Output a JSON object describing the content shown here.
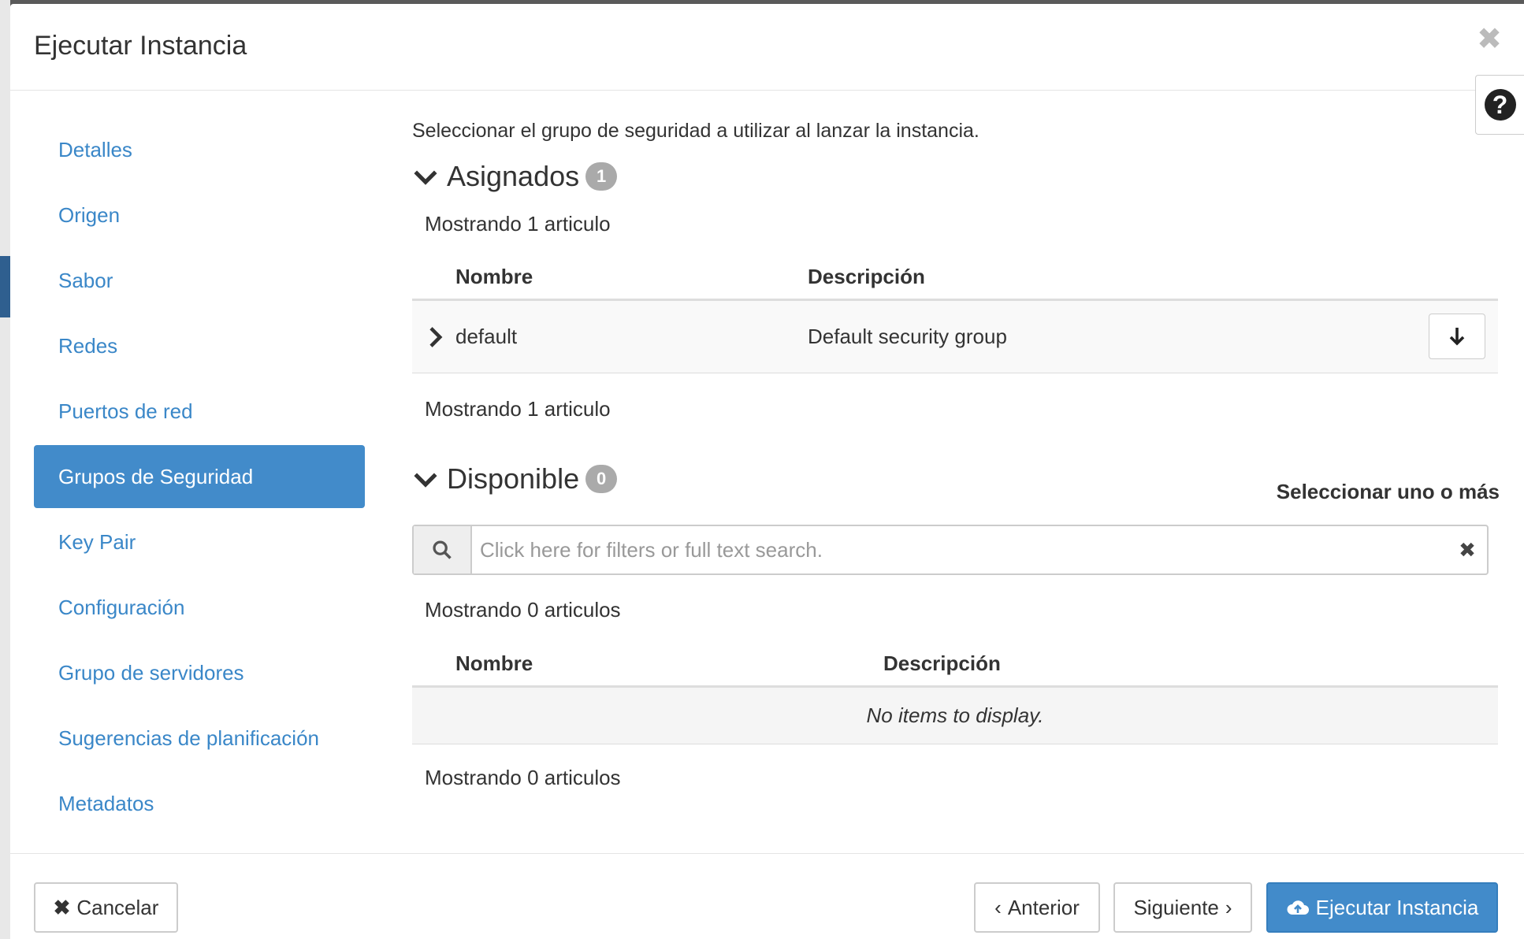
{
  "modal": {
    "title": "Ejecutar Instancia",
    "help_label": "?"
  },
  "sidebar": {
    "items": [
      {
        "label": "Detalles"
      },
      {
        "label": "Origen"
      },
      {
        "label": "Sabor"
      },
      {
        "label": "Redes"
      },
      {
        "label": "Puertos de red"
      },
      {
        "label": "Grupos de Seguridad",
        "active": true
      },
      {
        "label": "Key Pair"
      },
      {
        "label": "Configuración"
      },
      {
        "label": "Grupo de servidores"
      },
      {
        "label": "Sugerencias de planificación"
      },
      {
        "label": "Metadatos"
      }
    ]
  },
  "main": {
    "intro": "Seleccionar el grupo de seguridad a utilizar al lanzar la instancia.",
    "assigned": {
      "title": "Asignados",
      "badge": "1",
      "count_top": "Mostrando 1 articulo",
      "count_bottom": "Mostrando 1 articulo",
      "columns": [
        "Nombre",
        "Descripción"
      ],
      "rows": [
        {
          "name": "default",
          "description": "Default security group"
        }
      ]
    },
    "available": {
      "title": "Disponible",
      "badge": "0",
      "select_hint": "Seleccionar uno o más",
      "search_placeholder": "Click here for filters or full text search.",
      "count_top": "Mostrando 0 articulos",
      "count_bottom": "Mostrando 0 articulos",
      "columns": [
        "Nombre",
        "Descripción"
      ],
      "empty_text": "No items to display."
    }
  },
  "footer": {
    "cancel_label": "Cancelar",
    "prev_label": "Anterior",
    "next_label": "Siguiente",
    "launch_label": "Ejecutar Instancia"
  },
  "colors": {
    "accent": "#428bca",
    "link": "#3a87c8",
    "badge": "#aaaaaa"
  }
}
